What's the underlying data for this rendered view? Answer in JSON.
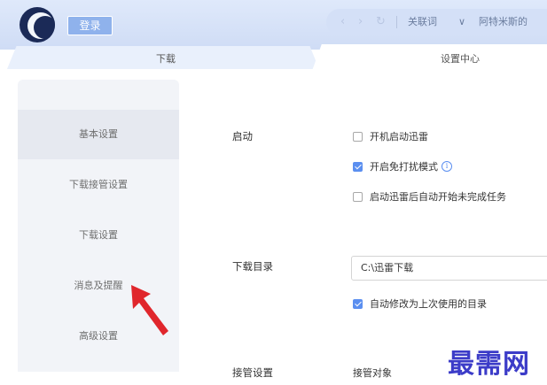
{
  "header": {
    "login_label": "登录",
    "nav_back": "‹",
    "nav_forward": "›",
    "nav_refresh": "↻",
    "associate_label": "关联词",
    "dropdown_glyph": "∨",
    "address_text": "阿特米斯的"
  },
  "tabs": [
    {
      "label": "下载"
    },
    {
      "label": "设置中心"
    }
  ],
  "sidebar": {
    "items": [
      {
        "label": "基本设置"
      },
      {
        "label": "下载接管设置"
      },
      {
        "label": "下载设置"
      },
      {
        "label": "消息及提醒"
      },
      {
        "label": "高级设置"
      }
    ]
  },
  "startup": {
    "label": "启动",
    "options": [
      {
        "label": "开机启动迅雷",
        "checked": false
      },
      {
        "label": "开启免打扰模式",
        "checked": true
      },
      {
        "label": "启动迅雷后自动开始未完成任务",
        "checked": false
      }
    ],
    "info_glyph": "i"
  },
  "download_dir": {
    "label": "下载目录",
    "value": "C:\\迅雷下载",
    "auto_modify_label": "自动修改为上次使用的目录",
    "auto_modify_checked": true
  },
  "takeover": {
    "label": "接管设置",
    "target_label": "接管对象"
  },
  "watermark": "最需网",
  "colors": {
    "accent": "#5b8ff0",
    "topbar": "#d4e0f7",
    "sidebar_bg": "#f2f4f8",
    "arrow": "#e0262c",
    "watermark": "#3c3cc8"
  }
}
